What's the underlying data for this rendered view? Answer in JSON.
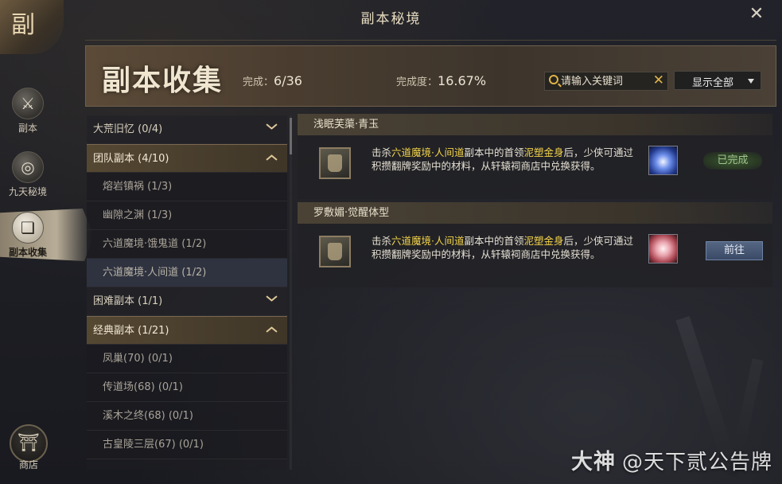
{
  "window": {
    "title": "副本秘境",
    "emblem_glyph": "副"
  },
  "nav": {
    "items": [
      {
        "label": "副本",
        "icon": "sword-circle-icon",
        "glyph": "⚔"
      },
      {
        "label": "九天秘境",
        "icon": "swirl-icon",
        "glyph": "◎"
      },
      {
        "label": "副本收集",
        "icon": "book-collection-icon",
        "glyph": "❏"
      }
    ],
    "shop": {
      "label": "商店",
      "glyph": "⛩"
    }
  },
  "header": {
    "title": "副本收集",
    "progress_label": "完成：",
    "progress_value": "6/36",
    "completion_label": "完成度：",
    "completion_value": "16.67%",
    "search_placeholder": "请输入关键词",
    "filter_value": "显示全部"
  },
  "list": [
    {
      "label": "大荒旧忆",
      "count": "(0/4)",
      "type": "cat",
      "open": false
    },
    {
      "label": "团队副本",
      "count": "(4/10)",
      "type": "cat",
      "open": true
    },
    {
      "label": "熔岩镇祸",
      "count": "(1/3)",
      "type": "sub"
    },
    {
      "label": "幽隙之渊",
      "count": "(1/3)",
      "type": "sub"
    },
    {
      "label": "六道魔境·饿鬼道",
      "count": "(1/2)",
      "type": "sub"
    },
    {
      "label": "六道魔境·人间道",
      "count": "(1/2)",
      "type": "sub",
      "selected": true
    },
    {
      "label": "困难副本",
      "count": "(1/1)",
      "type": "cat",
      "open": false
    },
    {
      "label": "经典副本",
      "count": "(1/21)",
      "type": "cat",
      "open": true
    },
    {
      "label": "凤巢(70)",
      "count": "(0/1)",
      "type": "sub"
    },
    {
      "label": "传道场(68)",
      "count": "(0/1)",
      "type": "sub"
    },
    {
      "label": "溪木之终(68)",
      "count": "(0/1)",
      "type": "sub"
    },
    {
      "label": "古皇陵三层(67)",
      "count": "(0/1)",
      "type": "sub"
    }
  ],
  "entries": [
    {
      "name": "浅眠芙蕖·青玉",
      "desc_pre": "击杀",
      "desc_dungeon": "六道魔境·人间道",
      "desc_mid": "副本中的首领",
      "desc_boss": "泥塑金身",
      "desc_post": "后，少侠可通过积攒翻牌奖励中的材料，从轩辕祠商店中兑换获得。",
      "reward_color": "blue",
      "status": "已完成"
    },
    {
      "name": "罗敷媚·觉醒体型",
      "desc_pre": "击杀",
      "desc_dungeon": "六道魔境·人间道",
      "desc_mid": "副本中的首领",
      "desc_boss": "泥塑金身",
      "desc_post": "后，少侠可通过积攒翻牌奖励中的材料，从轩辕祠商店中兑换获得。",
      "reward_color": "pink",
      "action": "前往"
    }
  ],
  "watermark": {
    "brand": "大神",
    "handle": "@天下贰公告牌"
  }
}
